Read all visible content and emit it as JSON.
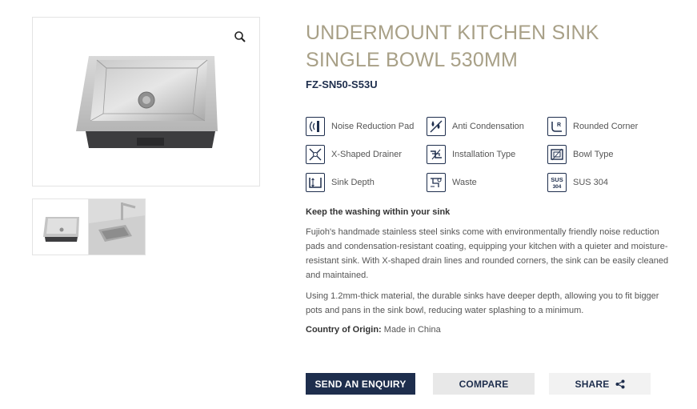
{
  "product": {
    "title": "UNDERMOUNT KITCHEN SINK SINGLE BOWL 530MM",
    "sku": "FZ-SN50-S53U"
  },
  "features": [
    {
      "icon": "noise-reduction-icon",
      "label": "Noise Reduction Pad"
    },
    {
      "icon": "anti-condensation-icon",
      "label": "Anti Condensation"
    },
    {
      "icon": "rounded-corner-icon",
      "label": "Rounded Corner"
    },
    {
      "icon": "x-shaped-drainer-icon",
      "label": "X-Shaped Drainer"
    },
    {
      "icon": "installation-type-icon",
      "label": "Installation Type"
    },
    {
      "icon": "bowl-type-icon",
      "label": "Bowl Type"
    },
    {
      "icon": "sink-depth-icon",
      "label": "Sink Depth"
    },
    {
      "icon": "waste-icon",
      "label": "Waste"
    },
    {
      "icon": "sus-304-icon",
      "label": "SUS 304",
      "icon_text_top": "SUS",
      "icon_text_bottom": "304"
    }
  ],
  "description": {
    "heading": "Keep the washing within your sink",
    "paragraph1": "Fujioh's handmade stainless steel sinks come with environmentally friendly noise reduction pads and condensation-resistant coating, equipping your kitchen with a quieter and moisture-resistant sink. With X-shaped drain lines and rounded corners, the sink can be easily cleaned and maintained.",
    "paragraph2": "Using 1.2mm-thick material, the durable sinks have deeper depth, allowing you to fit bigger pots and pans in the sink bowl, reducing water splashing to a minimum.",
    "origin_label": "Country of Origin:",
    "origin_value": "Made in China"
  },
  "buttons": {
    "enquiry": "SEND AN ENQUIRY",
    "compare": "COMPARE",
    "share": "SHARE"
  },
  "colors": {
    "navy": "#1e2e4d",
    "title_gold": "#a8a087"
  }
}
